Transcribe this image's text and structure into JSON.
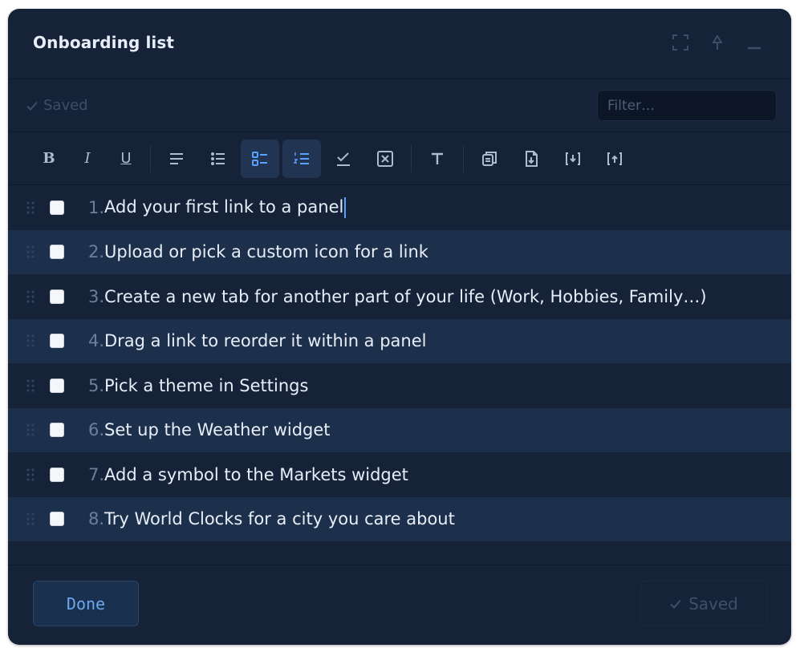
{
  "window": {
    "title": "Onboarding list",
    "icons": [
      "expand-icon",
      "pin-icon",
      "minimize-icon"
    ]
  },
  "status": {
    "saved_label": "Saved"
  },
  "filter": {
    "placeholder": "Filter…",
    "value": ""
  },
  "toolbar": {
    "bold": "B",
    "italic": "I",
    "underline": "U",
    "heading": "T",
    "active_items": [
      "checklist",
      "numbered-list"
    ]
  },
  "items": [
    {
      "num": "1.",
      "text": "Add your first link to a panel",
      "checked": false
    },
    {
      "num": "2.",
      "text": "Upload or pick a custom icon for a link",
      "checked": false
    },
    {
      "num": "3.",
      "text": "Create a new tab for another part of your life (Work,  Hobbies, Family…)",
      "checked": false
    },
    {
      "num": "4.",
      "text": "Drag a link to reorder it within a panel",
      "checked": false
    },
    {
      "num": "5.",
      "text": "Pick a theme in Settings",
      "checked": false
    },
    {
      "num": "6.",
      "text": "Set up the Weather widget",
      "checked": false
    },
    {
      "num": "7.",
      "text": "Add a symbol to the Markets widget",
      "checked": false
    },
    {
      "num": "8.",
      "text": "Try World Clocks for a city you care about",
      "checked": false
    }
  ],
  "footer": {
    "done_label": "Done",
    "saved_label": "Saved"
  },
  "colors": {
    "background": "#152238",
    "row_alt": "#1d304b",
    "accent": "#6aa8f0",
    "text": "#e8eef8"
  }
}
